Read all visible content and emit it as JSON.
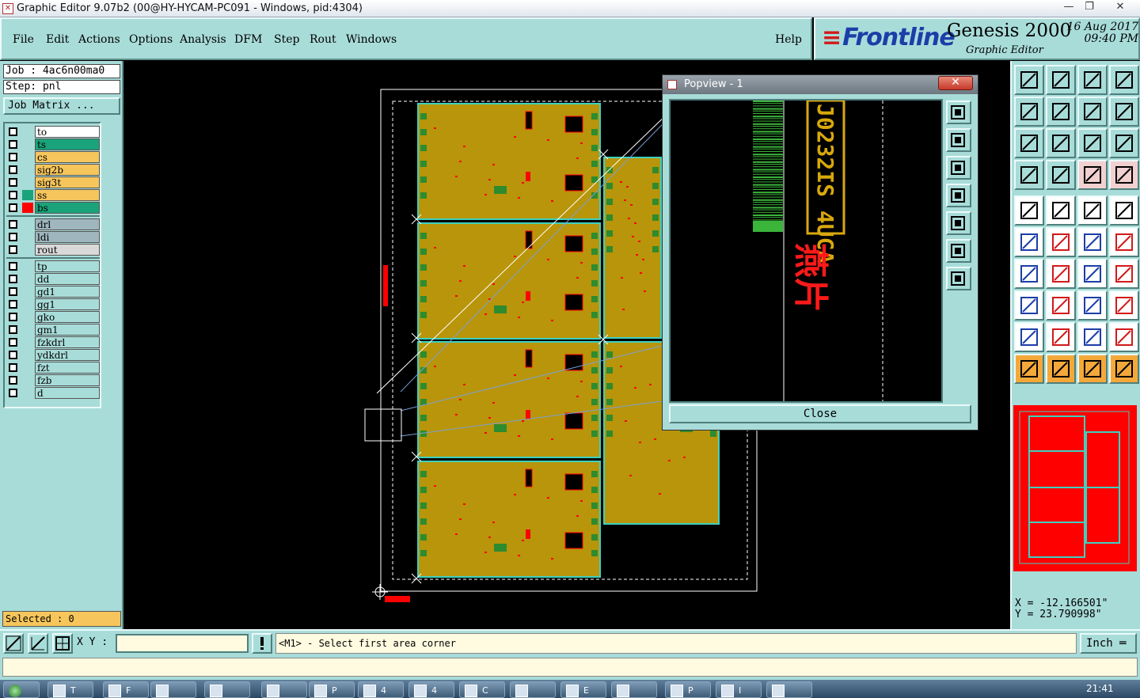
{
  "window": {
    "title": "Graphic Editor 9.07b2 (00@HY-HYCAM-PC091 - Windows, pid:4304)",
    "minimize": "—",
    "restore": "❐",
    "close": "✕"
  },
  "menu": [
    "File",
    "Edit",
    "Actions",
    "Options",
    "Analysis",
    "DFM",
    "Step",
    "Rout",
    "Windows"
  ],
  "help": "Help",
  "logo": {
    "brand": "Frontline",
    "product": "Genesis 2000",
    "subtitle": "Graphic Editor",
    "date": "16 Aug 2017",
    "time": "09:40 PM"
  },
  "job": {
    "job_line": "Job : 4ac6n00ma0",
    "step_line": "Step: pnl",
    "matrix_label": "Job Matrix ..."
  },
  "layers": [
    {
      "name": "to",
      "bg": "#ffffff",
      "swatch": "#a8dcd9"
    },
    {
      "name": "ts",
      "bg": "#1aa37a",
      "swatch": "#a8dcd9"
    },
    {
      "name": "cs",
      "bg": "#f6c65c",
      "swatch": "#a8dcd9"
    },
    {
      "name": "sig2b",
      "bg": "#f6c65c",
      "swatch": "#a8dcd9"
    },
    {
      "name": "sig3t",
      "bg": "#f6c65c",
      "swatch": "#a8dcd9"
    },
    {
      "name": "ss",
      "bg": "#f6c65c",
      "swatch": "#1aa37a"
    },
    {
      "name": "bs",
      "bg": "#1aa37a",
      "swatch": "#ff0000"
    },
    {
      "name": "drl",
      "bg": "#9fb6bf",
      "swatch": "#a8dcd9"
    },
    {
      "name": "ldi",
      "bg": "#9fb6bf",
      "swatch": "#a8dcd9"
    },
    {
      "name": "rout",
      "bg": "#d9d9d9",
      "swatch": "#a8dcd9"
    },
    {
      "name": "tp",
      "bg": "#a8dcd9",
      "swatch": "#a8dcd9"
    },
    {
      "name": "dd",
      "bg": "#a8dcd9",
      "swatch": "#a8dcd9"
    },
    {
      "name": "gd1",
      "bg": "#a8dcd9",
      "swatch": "#a8dcd9"
    },
    {
      "name": "gg1",
      "bg": "#a8dcd9",
      "swatch": "#a8dcd9"
    },
    {
      "name": "gko",
      "bg": "#a8dcd9",
      "swatch": "#a8dcd9"
    },
    {
      "name": "gm1",
      "bg": "#a8dcd9",
      "swatch": "#a8dcd9"
    },
    {
      "name": "fzkdrl",
      "bg": "#a8dcd9",
      "swatch": "#a8dcd9"
    },
    {
      "name": "ydkdrl",
      "bg": "#a8dcd9",
      "swatch": "#a8dcd9"
    },
    {
      "name": "fzt",
      "bg": "#a8dcd9",
      "swatch": "#a8dcd9"
    },
    {
      "name": "fzb",
      "bg": "#a8dcd9",
      "swatch": "#a8dcd9"
    },
    {
      "name": "d",
      "bg": "#a8dcd9",
      "swatch": "#a8dcd9"
    }
  ],
  "selected": "Selected : 0",
  "popview": {
    "title": "Popview - 1",
    "close_x": "✕",
    "close_button": "Close",
    "vertical_text": "J0232IS 4UCA",
    "chinese_text": "燕片"
  },
  "coords": {
    "x": "X = -12.166501\"",
    "y": "Y = 23.790998\""
  },
  "status": {
    "xy_label": "X Y :",
    "xy_value": "",
    "message": "<M1> - Select first area corner",
    "units": "Inch ═"
  },
  "taskbar": {
    "clock": "21:41",
    "tasks": [
      "T",
      "F",
      "",
      "",
      "",
      "P",
      "4",
      "4",
      "C",
      "",
      "E",
      "",
      "P",
      "I",
      ""
    ]
  },
  "colors": {
    "panel": "#a8dcd9",
    "board": "#b8950a",
    "board_edge": "#3fd0c0",
    "pad": "#2e8b2e",
    "accent_red": "#ff0000"
  }
}
